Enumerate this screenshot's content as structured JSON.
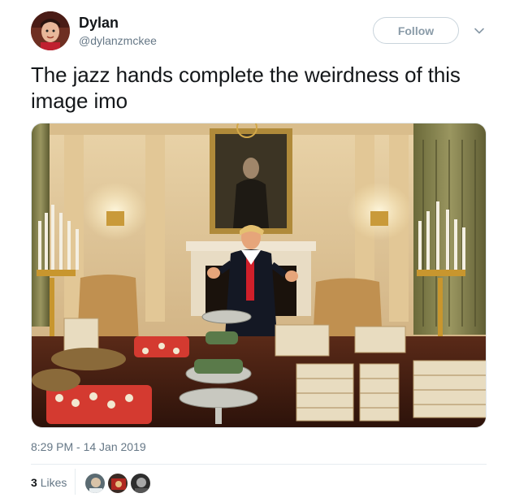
{
  "tweet": {
    "author": {
      "display_name": "Dylan",
      "handle": "@dylanzmckee",
      "avatar_icon": "profile-photo"
    },
    "follow_label": "Follow",
    "menu_icon": "chevron-down-icon",
    "text": "The jazz hands complete the weirdness of this image imo",
    "media": {
      "type": "photo"
    },
    "timestamp": "8:29 PM - 14 Jan 2019",
    "likes": {
      "count": "3",
      "label": "Likes"
    }
  },
  "colors": {
    "text_primary": "#14171a",
    "text_secondary": "#657786",
    "border": "#e6ecf0"
  }
}
